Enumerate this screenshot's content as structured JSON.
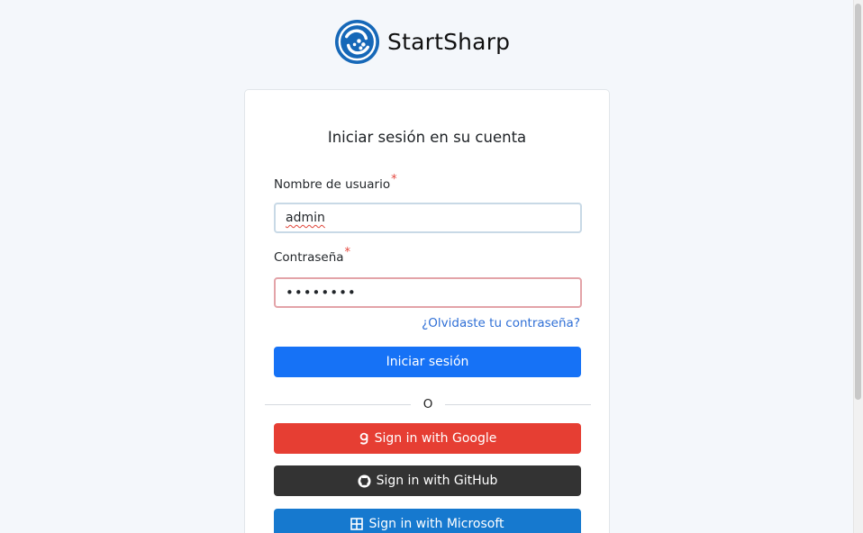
{
  "brand": {
    "name": "StartSharp",
    "logo_icon": "startsharp-logo-icon",
    "logo_color": "#1668b8"
  },
  "login": {
    "title": "Iniciar sesión en su cuenta",
    "username_label": "Nombre de usuario",
    "username_required": "*",
    "username_value": "admin",
    "password_label": "Contraseña",
    "password_required": "*",
    "password_value": "••••••••",
    "forgot_link": "¿Olvidaste tu contraseña?",
    "submit_label": "Iniciar sesión",
    "separator": "O"
  },
  "providers": [
    {
      "label": "Sign in with Google",
      "icon": "google-icon",
      "color": "#e63e33"
    },
    {
      "label": "Sign in with GitHub",
      "icon": "github-icon",
      "color": "#333333"
    },
    {
      "label": "Sign in with Microsoft",
      "icon": "microsoft-icon",
      "color": "#1679cf"
    }
  ],
  "colors": {
    "primary": "#1672f6",
    "required": "#e5483f",
    "link": "#2f6fd6"
  }
}
